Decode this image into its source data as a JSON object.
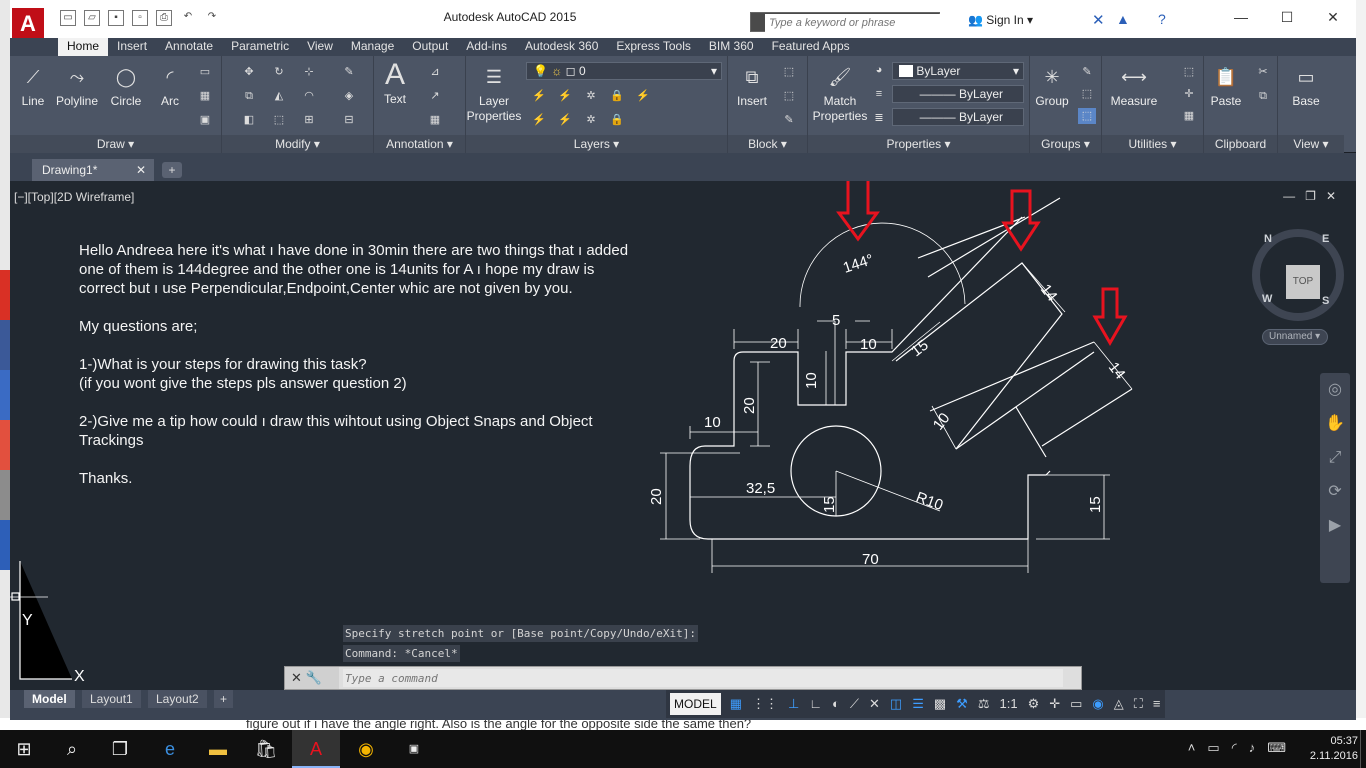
{
  "window": {
    "title": "Autodesk AutoCAD 2015",
    "logo": "A"
  },
  "search": {
    "placeholder": "Type a keyword or phrase"
  },
  "account": {
    "sign_in": "Sign In"
  },
  "ribbon_tabs": [
    "Home",
    "Insert",
    "Annotate",
    "Parametric",
    "View",
    "Manage",
    "Output",
    "Add-ins",
    "Autodesk 360",
    "Express Tools",
    "BIM 360",
    "Featured Apps"
  ],
  "ribbon": {
    "draw": {
      "title": "Draw",
      "line": "Line",
      "polyline": "Polyline",
      "circle": "Circle",
      "arc": "Arc"
    },
    "modify": {
      "title": "Modify"
    },
    "annotation": {
      "title": "Annotation",
      "text": "Text"
    },
    "layers": {
      "title": "Layers",
      "layer_properties": "Layer Properties",
      "current_layer": "0"
    },
    "block": {
      "title": "Block",
      "insert": "Insert"
    },
    "properties": {
      "title": "Properties",
      "match": "Match Properties",
      "color": "ByLayer",
      "linetype": "ByLayer",
      "lineweight": "ByLayer"
    },
    "groups": {
      "title": "Groups",
      "group": "Group"
    },
    "utilities": {
      "title": "Utilities",
      "measure": "Measure"
    },
    "clipboard": {
      "title": "Clipboard",
      "paste": "Paste"
    },
    "view": {
      "title": "View",
      "base": "Base"
    }
  },
  "document_tab": {
    "name": "Drawing1*"
  },
  "viewport": {
    "label": "[−][Top][2D Wireframe]",
    "viewcube_top": "TOP",
    "compass": {
      "n": "N",
      "e": "E",
      "s": "S",
      "w": "W"
    },
    "ucs_name": "Unnamed"
  },
  "note": {
    "paragraphs": [
      "Hello Andreea here it's what ı have done in 30min there are two things that ı added one of them is 144degree and the other one is 14units for A ı hope my draw is correct but ı use Perpendicular,Endpoint,Center whic are not given by you.",
      "My questions are;",
      "1-)What is your steps for drawing this task?",
      "(if you wont give the steps pls answer question 2)",
      "2-)Give me a tip how could ı draw this wihtout using Object Snaps and Object Trackings",
      "Thanks."
    ]
  },
  "dimensions": {
    "angle": "144°",
    "d5": "5",
    "d20_top": "20",
    "d10_top": "10",
    "d10_slot": "10",
    "d20_left": "20",
    "d10_left": "10",
    "d20_outer": "20",
    "d325": "32,5",
    "d15_center": "15",
    "r10": "R10",
    "d15_right": "15",
    "d70": "70",
    "d15_arm": "15",
    "d10_arm": "10",
    "d14_upper": "14",
    "d14_lower": "14"
  },
  "ucs": {
    "x": "X",
    "y": "Y"
  },
  "command": {
    "history": [
      "Specify stretch point or [Base point/Copy/Undo/eXit]:",
      "Command: *Cancel*"
    ],
    "placeholder": "Type a command"
  },
  "layout_tabs": [
    "Model",
    "Layout1",
    "Layout2"
  ],
  "status": {
    "model": "MODEL",
    "scale": "1:1"
  },
  "background_text": "figure out if ı have the angle right. Also is the angle for the opposite side the same then?",
  "clock": {
    "time": "05:37",
    "date": "2.11.2016"
  },
  "colors": {
    "accent_red": "#e8131f",
    "drawing_bg": "#212830",
    "ribbon_bg": "#4c5565"
  }
}
